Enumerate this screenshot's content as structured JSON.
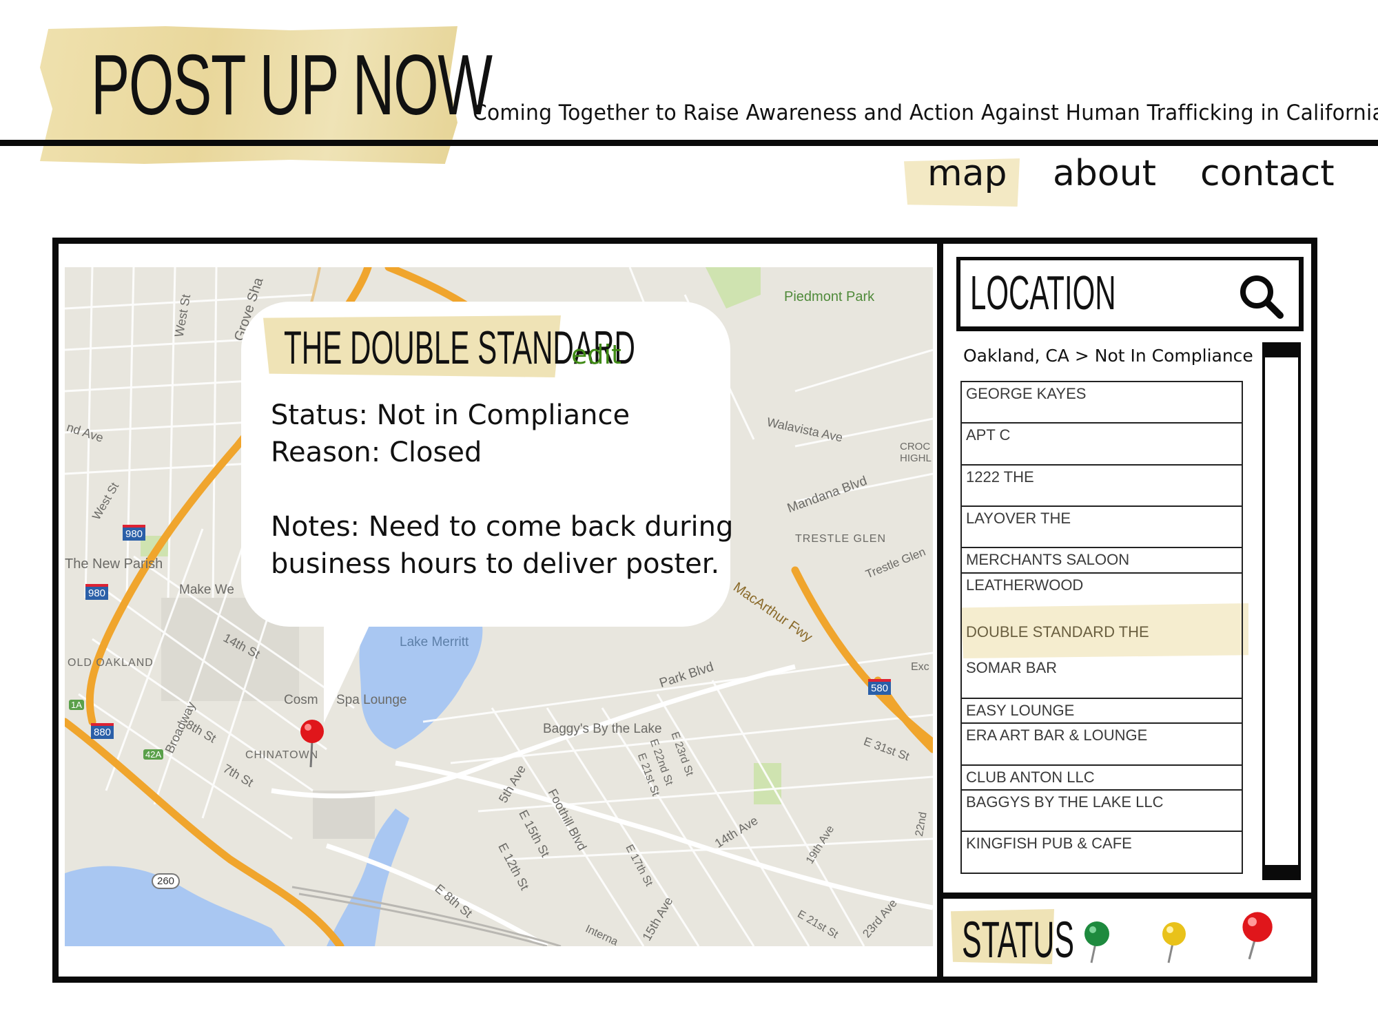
{
  "header": {
    "logo": "POST UP NOW",
    "tagline": "Coming Together to Raise Awareness and Action Against Human Trafficking in California"
  },
  "nav": {
    "items": [
      {
        "label": "map",
        "active": true
      },
      {
        "label": "about",
        "active": false
      },
      {
        "label": "contact",
        "active": false
      }
    ]
  },
  "map": {
    "labels": [
      "Piedmont Park",
      "West St",
      "Grove Sha",
      "nd Ave",
      "West St",
      "Walavista Ave",
      "CROC HIGHL",
      "Mandana Blvd",
      "TRESTLE GLEN",
      "Trestle Glen",
      "The New Parish",
      "Make We",
      "14th St",
      "OLD OAKLAND",
      "Lake Merritt",
      "MacArthur Fwy",
      "Park Blvd",
      "Exc",
      "Cosm",
      "Spa Lounge",
      "Broadway",
      "8th St",
      "CHINATOWN",
      "7th St",
      "Baggy's By the Lake",
      "E 31st St",
      "E 22nd St",
      "E 23rd St",
      "E 21st St",
      "5th Ave",
      "Foothill Blvd",
      "E 15th St",
      "E 12th St",
      "E 17th St",
      "14th Ave",
      "19th Ave",
      "E 8th St",
      "Interna",
      "15th Ave",
      "E 21st St",
      "23rd Ave",
      "22nd"
    ],
    "shields": [
      "980",
      "980",
      "880",
      "580",
      "260",
      "42A",
      "1A"
    ],
    "popup": {
      "title": "THE DOUBLE STANDARD",
      "edit_label": "edit",
      "status_line": "Status: Not in Compliance",
      "reason_line": "Reason: Closed",
      "notes_line1": "Notes: Need to come back during",
      "notes_line2": "business hours to deliver poster."
    }
  },
  "sidebar": {
    "search_label": "LOCATION",
    "search_icon": "search-icon",
    "breadcrumb": "Oakland, CA > Not In Compliance",
    "locations": [
      "GEORGE KAYES",
      "APT C",
      "1222 THE",
      "LAYOVER THE",
      "MERCHANTS SALOON",
      "LEATHERWOOD",
      "DOUBLE STANDARD THE",
      "SOMAR BAR",
      "EASY LOUNGE",
      "ERA ART BAR & LOUNGE",
      "CLUB ANTON LLC",
      "BAGGYS BY THE LAKE LLC",
      "KINGFISH PUB & CAFE"
    ],
    "selected_index": 6,
    "status_label": "STATUS",
    "status_pins": [
      {
        "name": "green-pin-icon",
        "color": "#1e8a3e"
      },
      {
        "name": "yellow-pin-icon",
        "color": "#e9c21a"
      },
      {
        "name": "red-pin-icon",
        "color": "#e0161b"
      }
    ]
  },
  "colors": {
    "tape": "#efe3b6",
    "edit": "#3f8a15",
    "highway": "#f0a52d",
    "water": "#a9c7f2",
    "park": "#cfe3b0"
  }
}
